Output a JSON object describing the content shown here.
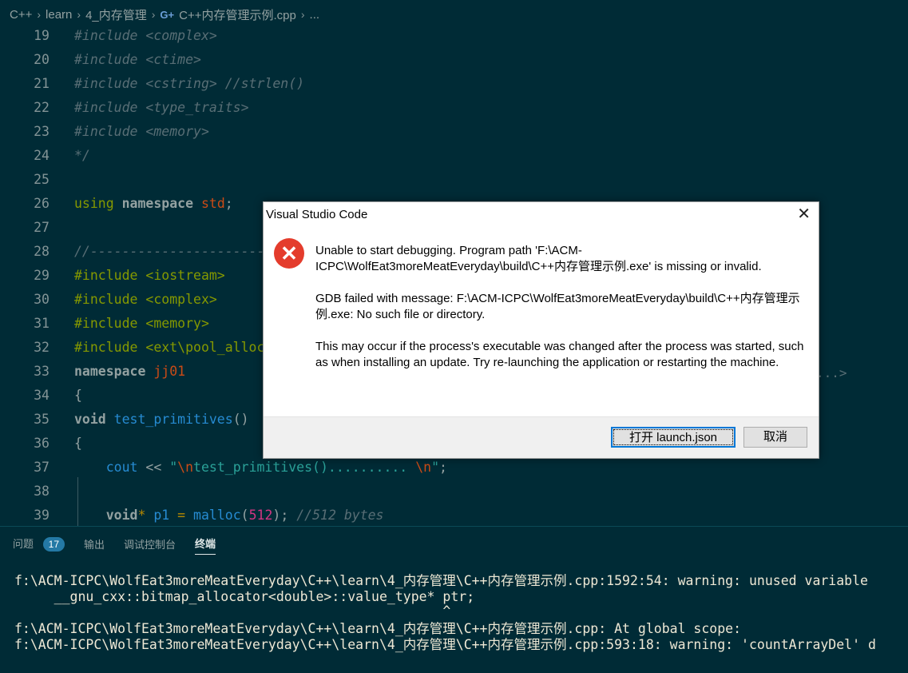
{
  "breadcrumb": {
    "items": [
      "C++",
      "learn",
      "4_内存管理",
      "C++内存管理示例.cpp",
      "..."
    ],
    "separator": "›"
  },
  "editor": {
    "lines": [
      {
        "num": "19",
        "tokens": [
          [
            "c-comment",
            "#include <complex>"
          ]
        ]
      },
      {
        "num": "20",
        "tokens": [
          [
            "c-comment",
            "#include <ctime>"
          ]
        ]
      },
      {
        "num": "21",
        "tokens": [
          [
            "c-comment",
            "#include <cstring> //strlen()"
          ]
        ]
      },
      {
        "num": "22",
        "tokens": [
          [
            "c-comment",
            "#include <type_traits>"
          ]
        ]
      },
      {
        "num": "23",
        "tokens": [
          [
            "c-comment",
            "#include <memory>"
          ]
        ]
      },
      {
        "num": "24",
        "tokens": [
          [
            "c-comment",
            "*/"
          ]
        ]
      },
      {
        "num": "25",
        "tokens": []
      },
      {
        "num": "26",
        "tokens": [
          [
            "c-kw",
            "using "
          ],
          [
            "c-bold",
            "namespace "
          ],
          [
            "c-red",
            "std"
          ],
          [
            "c-text",
            ";"
          ]
        ]
      },
      {
        "num": "27",
        "tokens": []
      },
      {
        "num": "28",
        "tokens": [
          [
            "c-comment",
            "//---------------------------------"
          ]
        ]
      },
      {
        "num": "29",
        "tokens": [
          [
            "c-pre",
            "#include <iostream>"
          ]
        ]
      },
      {
        "num": "30",
        "tokens": [
          [
            "c-pre",
            "#include <complex>"
          ]
        ]
      },
      {
        "num": "31",
        "tokens": [
          [
            "c-pre",
            "#include <memory>"
          ]
        ]
      },
      {
        "num": "32",
        "tokens": [
          [
            "c-pre",
            "#include <ext\\pool_alloca"
          ]
        ]
      },
      {
        "num": "33",
        "tokens": [
          [
            "c-bold",
            "namespace "
          ],
          [
            "c-red",
            "jj01"
          ]
        ]
      },
      {
        "num": "34",
        "tokens": [
          [
            "c-text",
            "{"
          ]
        ]
      },
      {
        "num": "35",
        "tokens": [
          [
            "c-bold",
            "void "
          ],
          [
            "c-fn",
            "test_primitives"
          ],
          [
            "c-text",
            "()"
          ]
        ]
      },
      {
        "num": "36",
        "tokens": [
          [
            "c-text",
            "{"
          ]
        ]
      },
      {
        "num": "37",
        "tokens": [
          [
            "c-fn",
            "    cout "
          ],
          [
            "c-text",
            "<< "
          ],
          [
            "c-str",
            "\""
          ],
          [
            "c-red",
            "\\n"
          ],
          [
            "c-str",
            "test_primitives().......... "
          ],
          [
            "c-red",
            "\\n"
          ],
          [
            "c-str",
            "\""
          ],
          [
            "c-text",
            ";"
          ]
        ]
      },
      {
        "num": "38",
        "tokens": []
      },
      {
        "num": "39",
        "tokens": [
          [
            "c-bold",
            "    void"
          ],
          [
            "c-yellow",
            "* "
          ],
          [
            "c-fn",
            "p1 "
          ],
          [
            "c-yellow",
            "= "
          ],
          [
            "c-fn",
            "malloc"
          ],
          [
            "c-text",
            "("
          ],
          [
            "c-num",
            "512"
          ],
          [
            "c-text",
            "); "
          ],
          [
            "c-comment",
            "//512 bytes"
          ]
        ]
      }
    ],
    "ghost_text": "...>"
  },
  "panel": {
    "tabs": [
      {
        "label": "问题",
        "badge": "17",
        "active": false
      },
      {
        "label": "输出",
        "active": false
      },
      {
        "label": "调试控制台",
        "active": false
      },
      {
        "label": "终端",
        "active": true
      }
    ],
    "terminal": [
      "f:\\ACM-ICPC\\WolfEat3moreMeatEveryday\\C++\\learn\\4_内存管理\\C++内存管理示例.cpp:1592:54: warning: unused variable",
      "     __gnu_cxx::bitmap_allocator<double>::value_type* ptr;",
      "                                                      ^",
      "f:\\ACM-ICPC\\WolfEat3moreMeatEveryday\\C++\\learn\\4_内存管理\\C++内存管理示例.cpp: At global scope:",
      "f:\\ACM-ICPC\\WolfEat3moreMeatEveryday\\C++\\learn\\4_内存管理\\C++内存管理示例.cpp:593:18: warning: 'countArrayDel' d"
    ]
  },
  "dialog": {
    "title": "Visual Studio Code",
    "close_glyph": "✕",
    "icon": "error-icon",
    "message_1": "Unable to start debugging. Program path 'F:\\ACM-ICPC\\WolfEat3moreMeatEveryday\\build\\C++内存管理示例.exe' is missing or invalid.",
    "message_2": "GDB failed with message: F:\\ACM-ICPC\\WolfEat3moreMeatEveryday\\build\\C++内存管理示例.exe: No such file or directory.",
    "message_3": "This may occur if the process's executable was changed after the process was started, such as when installing an update. Try re-launching the application or restarting the machine.",
    "primary_button": "打开 launch.json",
    "secondary_button": "取消"
  }
}
